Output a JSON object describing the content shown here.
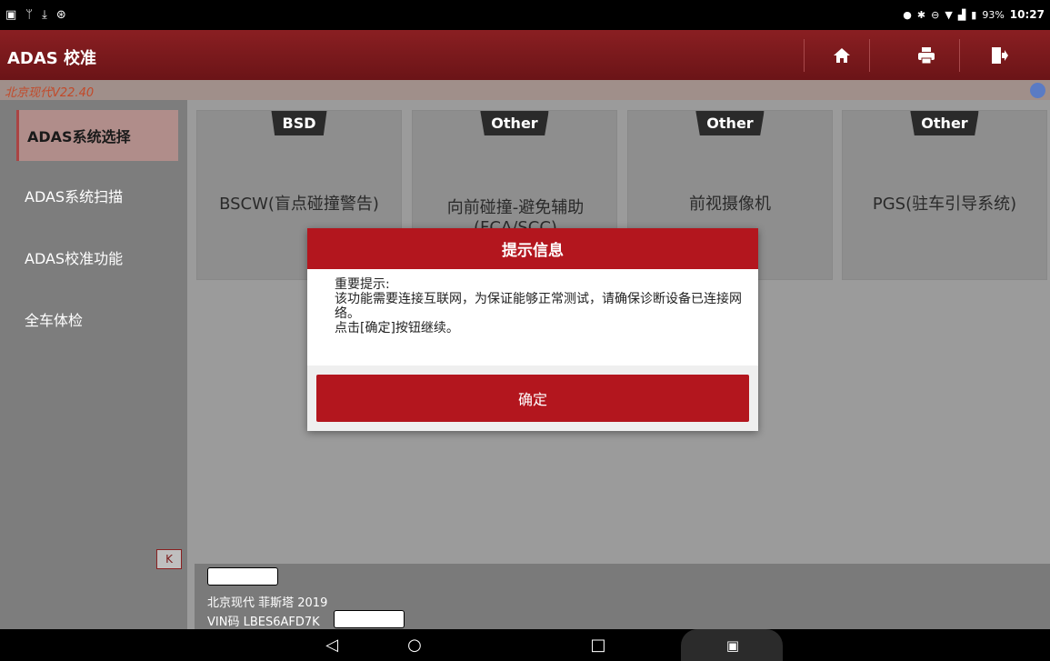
{
  "status_bar": {
    "left_icons": [
      "gallery-icon",
      "usb-icon",
      "download-icon",
      "settings-icon"
    ],
    "right_icons": [
      "location-icon",
      "bluetooth-icon",
      "dnd-icon",
      "wifi-icon",
      "signal-icon",
      "battery-icon"
    ],
    "battery": "93%",
    "time": "10:27"
  },
  "header": {
    "title": "ADAS 校准",
    "buttons": [
      "home-icon",
      "print-icon",
      "exit-icon"
    ]
  },
  "subheader": {
    "version": "北京现代V22.40"
  },
  "sidebar": {
    "items": [
      {
        "label": "ADAS系统选择",
        "active": true
      },
      {
        "label": "ADAS系统扫描",
        "active": false
      },
      {
        "label": "ADAS校准功能",
        "active": false
      },
      {
        "label": "全车体检",
        "active": false
      }
    ],
    "collapse_label": "K"
  },
  "cards": [
    {
      "tag": "BSD",
      "label": "BSCW(盲点碰撞警告)"
    },
    {
      "tag": "Other",
      "label": "向前碰撞-避免辅助 (FCA/SCC)"
    },
    {
      "tag": "Other",
      "label": "前视摄像机"
    },
    {
      "tag": "Other",
      "label": "PGS(驻车引导系统)"
    }
  ],
  "vehicle": {
    "model": "北京现代 菲斯塔 2019",
    "vin": "VIN码 LBES6AFD7K"
  },
  "dialog": {
    "title": "提示信息",
    "line1": "重要提示:",
    "line2": "该功能需要连接互联网，为保证能够正常测试，请确保诊断设备已连接网络。",
    "line3": "点击[确定]按钮继续。",
    "confirm": "确定"
  },
  "navbar": {
    "icons": [
      "back-icon",
      "home-circle-icon",
      "recents-icon",
      "screenshot-icon"
    ]
  }
}
